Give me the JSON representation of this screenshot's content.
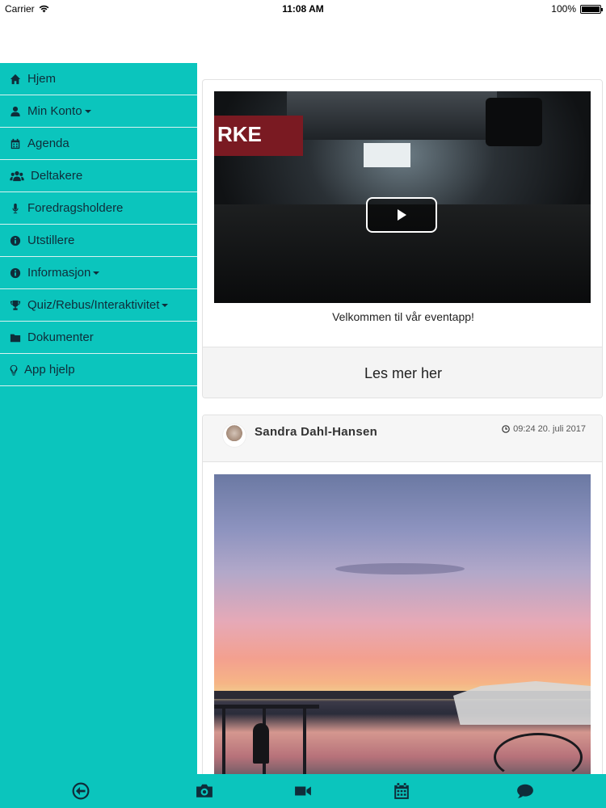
{
  "status_bar": {
    "carrier": "Carrier",
    "time": "11:08 AM",
    "battery": "100%"
  },
  "sidebar": {
    "items": [
      {
        "label": "Hjem",
        "icon": "home-icon",
        "has_dropdown": false
      },
      {
        "label": "Min Konto",
        "icon": "user-icon",
        "has_dropdown": true
      },
      {
        "label": "Agenda",
        "icon": "calendar-icon",
        "has_dropdown": false
      },
      {
        "label": "Deltakere",
        "icon": "users-icon",
        "has_dropdown": false
      },
      {
        "label": "Foredragsholdere",
        "icon": "microphone-icon",
        "has_dropdown": false
      },
      {
        "label": "Utstillere",
        "icon": "info-icon",
        "has_dropdown": false
      },
      {
        "label": "Informasjon",
        "icon": "info-icon",
        "has_dropdown": true
      },
      {
        "label": "Quiz/Rebus/Interaktivitet",
        "icon": "trophy-icon",
        "has_dropdown": true
      },
      {
        "label": "Dokumenter",
        "icon": "folder-icon",
        "has_dropdown": false
      },
      {
        "label": "App hjelp",
        "icon": "lightbulb-icon",
        "has_dropdown": false
      }
    ]
  },
  "feed": {
    "video_card": {
      "banner_text": "RKE",
      "caption": "Velkommen til vår eventapp!",
      "button_label": "Les mer her"
    },
    "post": {
      "author": "Sandra Dahl-Hansen",
      "time": "09:24 20. juli 2017"
    }
  },
  "bottom_bar": {
    "icons": [
      "back-circle-icon",
      "camera-icon",
      "video-camera-icon",
      "calendar-icon",
      "chat-bubble-icon"
    ]
  },
  "colors": {
    "accent": "#0bc5bd",
    "text_dark": "#0f2d3a"
  }
}
